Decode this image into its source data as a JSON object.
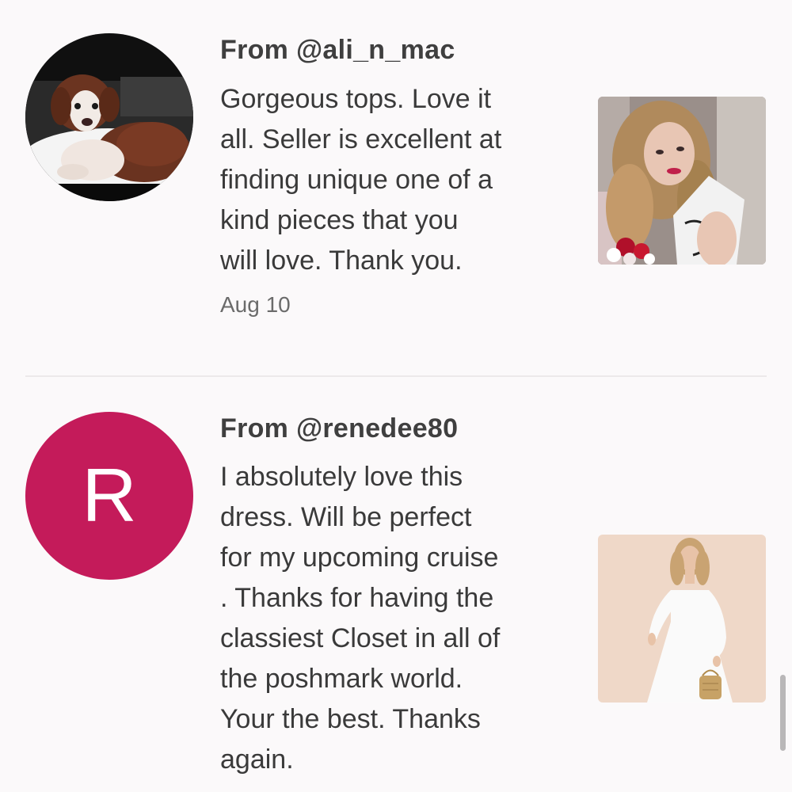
{
  "reviews": [
    {
      "from": "From @ali_n_mac",
      "avatar_type": "photo",
      "avatar_icon": "puppy-photo",
      "body_lines": [
        "Gorgeous tops. Love it",
        "all. Seller is excellent at",
        "finding unique one of a",
        "kind pieces that you",
        "will love. Thank you."
      ],
      "date": "Aug 10",
      "thumbnail_icon": "woman-white-top-photo"
    },
    {
      "from": "From @renedee80",
      "avatar_type": "letter",
      "avatar_letter": "R",
      "avatar_color": "#c41b5a",
      "body_lines": [
        "I absolutely love this",
        "dress. Will be perfect",
        "for my upcoming cruise",
        ". Thanks for having the",
        "classiest Closet in all of",
        "the poshmark world.",
        "Your the best. Thanks",
        "again."
      ],
      "thumbnail_icon": "woman-white-dress-photo"
    }
  ]
}
